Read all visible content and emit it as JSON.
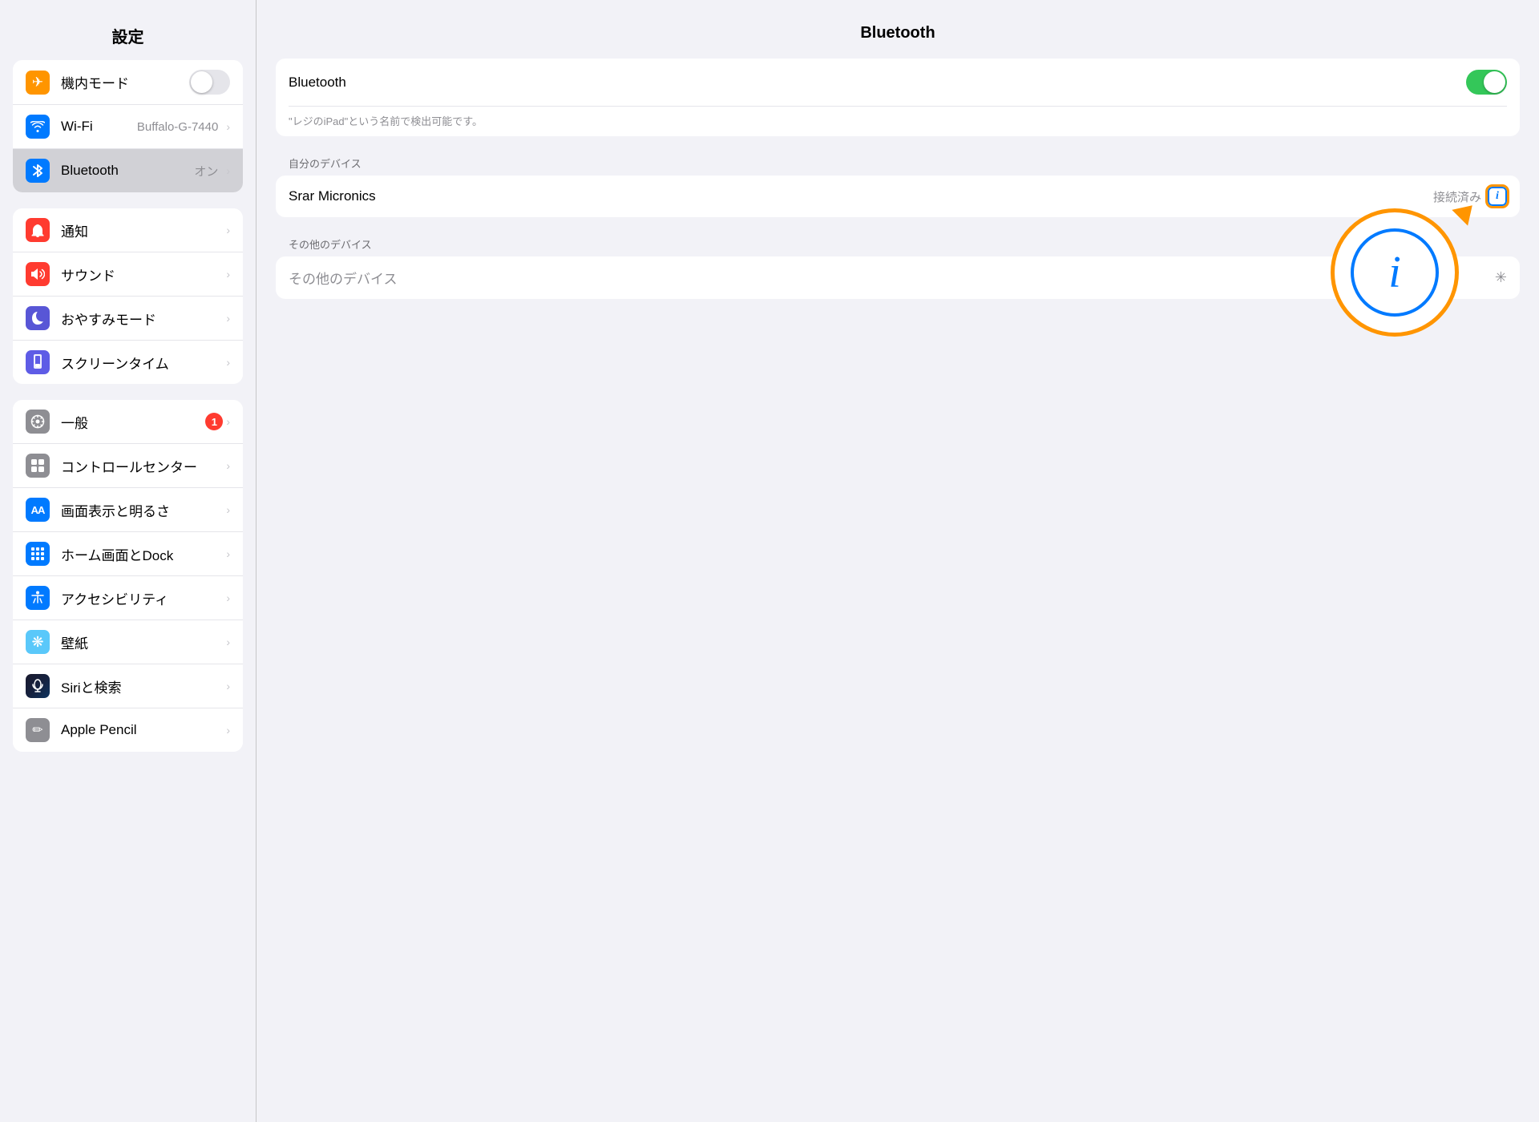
{
  "sidebar": {
    "title": "設定",
    "groups": [
      {
        "id": "group1",
        "items": [
          {
            "id": "airplane",
            "label": "機内モード",
            "icon": "✈",
            "iconBg": "bg-orange",
            "value": "",
            "type": "toggle-off"
          },
          {
            "id": "wifi",
            "label": "Wi-Fi",
            "icon": "wifi",
            "iconBg": "bg-blue",
            "value": "Buffalo-G-7440",
            "type": "value"
          },
          {
            "id": "bluetooth",
            "label": "Bluetooth",
            "icon": "bluetooth",
            "iconBg": "bg-blue2",
            "value": "オン",
            "type": "value",
            "active": true
          }
        ]
      },
      {
        "id": "group2",
        "items": [
          {
            "id": "notifications",
            "label": "通知",
            "icon": "bell",
            "iconBg": "bg-red",
            "value": "",
            "type": "chevron"
          },
          {
            "id": "sounds",
            "label": "サウンド",
            "icon": "sound",
            "iconBg": "bg-red2",
            "value": "",
            "type": "chevron"
          },
          {
            "id": "donotdisturb",
            "label": "おやすみモード",
            "icon": "moon",
            "iconBg": "bg-purple",
            "value": "",
            "type": "chevron"
          },
          {
            "id": "screentime",
            "label": "スクリーンタイム",
            "icon": "hourglass",
            "iconBg": "bg-purple2",
            "value": "",
            "type": "chevron"
          }
        ]
      },
      {
        "id": "group3",
        "items": [
          {
            "id": "general",
            "label": "一般",
            "icon": "gear",
            "iconBg": "bg-gray",
            "value": "",
            "type": "badge",
            "badge": "1"
          },
          {
            "id": "controlcenter",
            "label": "コントロールセンター",
            "icon": "controlcenter",
            "iconBg": "bg-gray",
            "value": "",
            "type": "chevron"
          },
          {
            "id": "display",
            "label": "画面表示と明るさ",
            "icon": "AA",
            "iconBg": "bg-blue",
            "value": "",
            "type": "chevron"
          },
          {
            "id": "homescreen",
            "label": "ホーム画面とDock",
            "icon": "grid",
            "iconBg": "bg-blue2",
            "value": "",
            "type": "chevron"
          },
          {
            "id": "accessibility",
            "label": "アクセシビリティ",
            "icon": "♿",
            "iconBg": "bg-blue",
            "value": "",
            "type": "chevron"
          },
          {
            "id": "wallpaper",
            "label": "壁紙",
            "icon": "❋",
            "iconBg": "bg-teal",
            "value": "",
            "type": "chevron"
          },
          {
            "id": "siri",
            "label": "Siriと検索",
            "icon": "siri",
            "iconBg": "bg-darkblue",
            "value": "",
            "type": "chevron"
          },
          {
            "id": "applepencil",
            "label": "Apple Pencil",
            "icon": "✏",
            "iconBg": "bg-gray",
            "value": "",
            "type": "chevron"
          }
        ]
      }
    ]
  },
  "main": {
    "title": "Bluetooth",
    "bt_label": "Bluetooth",
    "bt_description": "\"レジのiPad\"という名前で検出可能です。",
    "my_devices_label": "自分のデバイス",
    "device_name": "Srar Micronics",
    "device_status": "接続済み",
    "other_devices_label": "その他のデバイス",
    "info_button_label": "i"
  },
  "colors": {
    "accent": "#007aff",
    "green": "#34c759",
    "orange": "#ff9500",
    "red": "#ff3b30"
  }
}
